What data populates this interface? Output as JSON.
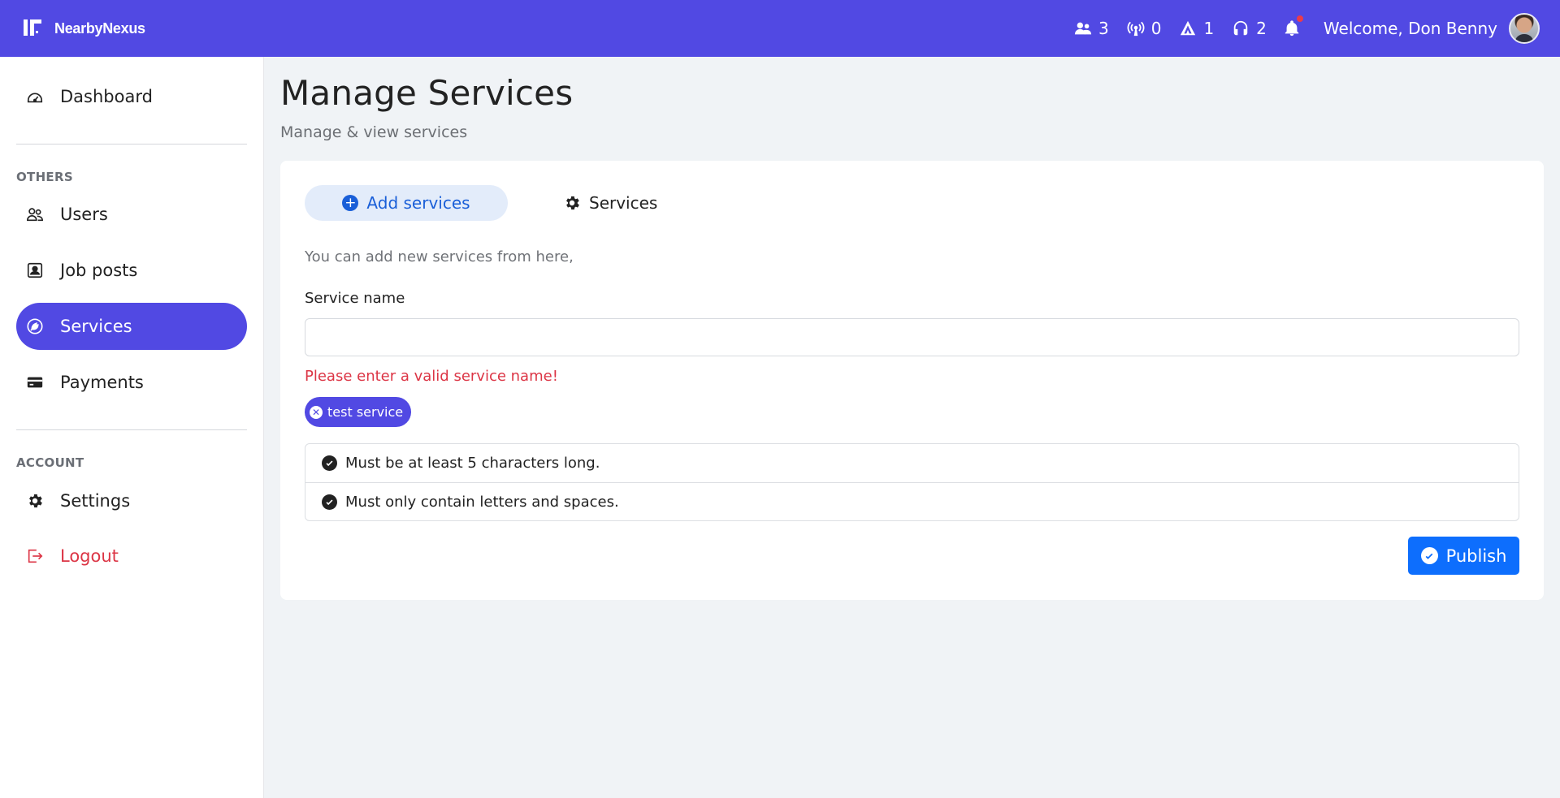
{
  "header": {
    "brand": "NearbyNexus",
    "stats": [
      {
        "icon": "users-icon",
        "value": "3"
      },
      {
        "icon": "broadcast-icon",
        "value": "0"
      },
      {
        "icon": "tent-icon",
        "value": "1"
      },
      {
        "icon": "headset-icon",
        "value": "2"
      }
    ],
    "notification_icon": "bell-icon",
    "welcome": "Welcome, Don Benny"
  },
  "sidebar": {
    "dashboard": "Dashboard",
    "others_label": "OTHERS",
    "items": [
      {
        "label": "Users",
        "icon": "users-icon"
      },
      {
        "label": "Job posts",
        "icon": "job-posts-icon"
      },
      {
        "label": "Services",
        "icon": "services-icon",
        "active": true
      },
      {
        "label": "Payments",
        "icon": "credit-card-icon"
      }
    ],
    "account_label": "ACCOUNT",
    "settings": "Settings",
    "logout": "Logout"
  },
  "main": {
    "title": "Manage Services",
    "subtitle": "Manage & view services",
    "tabs": {
      "add": "Add services",
      "services": "Services"
    },
    "hint": "You can add new services from here,",
    "field_label": "Service name",
    "input_value": "",
    "error": "Please enter a valid service name!",
    "chip": "test service",
    "rules": [
      "Must be at least 5 characters long.",
      "Must only contain letters and spaces."
    ],
    "publish": "Publish"
  },
  "colors": {
    "primary": "#5149e3",
    "link_blue": "#1a5fd8",
    "button_blue": "#0d6efd",
    "error": "#dc3545"
  }
}
